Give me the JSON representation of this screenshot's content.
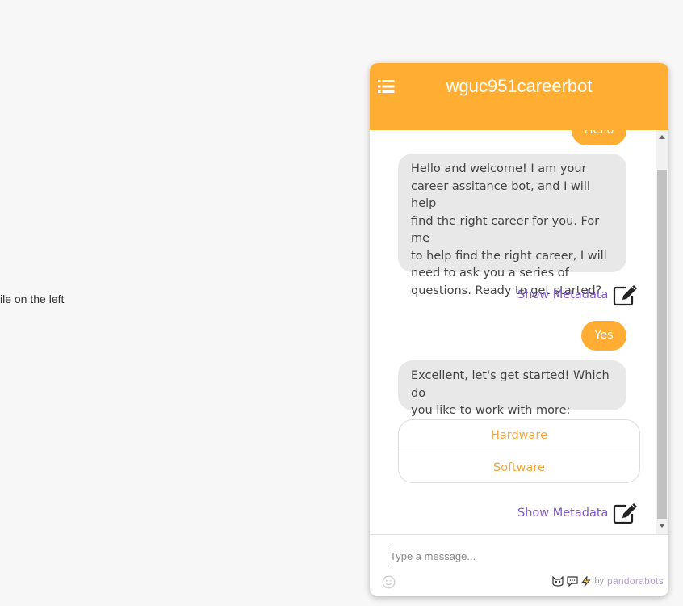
{
  "background_text": "ile on the left",
  "chat": {
    "title": "wguc951careerbot",
    "header_color": "#ffae33",
    "messages": {
      "user_hello": "Hello",
      "bot_welcome_lines": [
        "Hello and welcome! I am your",
        "career assitance bot, and I will help",
        "find the right career for you. For me",
        "to help find the right career, I will",
        "need to ask you a series of",
        "questions. Ready to get started?"
      ],
      "user_yes": "Yes",
      "bot_excellent_lines": [
        "Excellent, let's get started! Which do",
        "you like to work with more:"
      ]
    },
    "choices": [
      "Hardware",
      "Software"
    ],
    "metadata_label": "Show Metadata",
    "input_placeholder": "Type a message...",
    "branding": {
      "by": "by",
      "name": "pandorabots"
    },
    "icons": {
      "menu": "list-icon",
      "metadata": "edit-icon",
      "emoji": "smiley-icon"
    },
    "accent_purple": "#7e57c2",
    "choice_color": "#f5a53a"
  }
}
